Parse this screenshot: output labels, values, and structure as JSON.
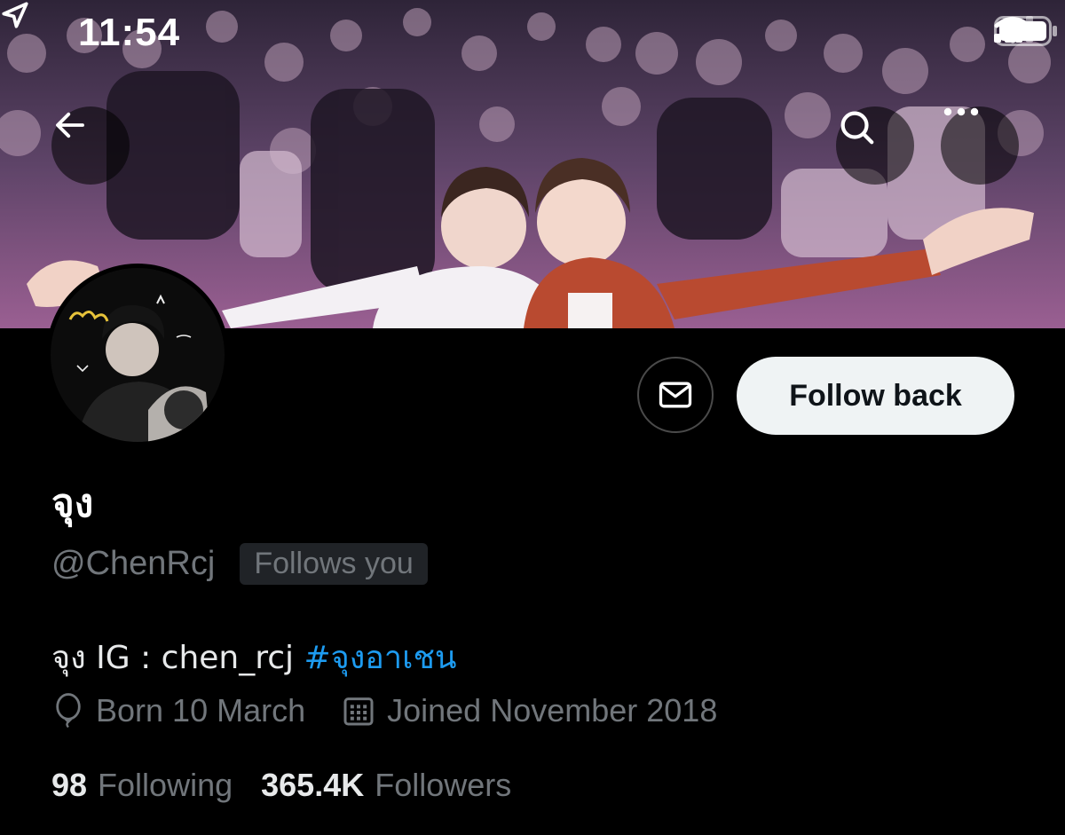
{
  "status_bar": {
    "time": "11:54"
  },
  "header": {
    "back_icon": "back-arrow-icon",
    "search_icon": "search-icon",
    "more_icon": "more-icon"
  },
  "actions": {
    "message_icon": "mail-icon",
    "follow_label": "Follow back"
  },
  "profile": {
    "display_name": "จุง",
    "handle": "@ChenRcj",
    "follows_you": "Follows you",
    "bio_text": "จุง IG : chen_rcj ",
    "bio_hashtag": "#จุงอาเชน",
    "birthday": "Born 10 March",
    "joined": "Joined November 2018",
    "following_count": "98",
    "following_label": "Following",
    "followers_count": "365.4K",
    "followers_label": "Followers"
  },
  "colors": {
    "background": "#000000",
    "text_primary": "#e7e9ea",
    "text_secondary": "#71767b",
    "link": "#1d9bf0",
    "follow_button_bg": "#eff3f4"
  }
}
